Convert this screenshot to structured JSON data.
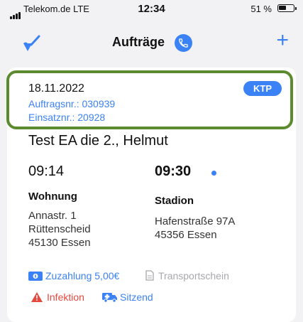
{
  "status_bar": {
    "carrier": "Telekom.de  LTE",
    "time": "12:34",
    "battery_text": "51 %",
    "battery_level": 0.51
  },
  "nav": {
    "title": "Aufträge",
    "icons": {
      "left": "broom-icon",
      "call": "phone-icon",
      "add": "plus-icon"
    },
    "add_label": "+"
  },
  "order": {
    "date": "18.11.2022",
    "order_number": "Auftragsnr.: 030939",
    "mission_number": "Einsatznr.: 20928",
    "badge": "KTP",
    "patient": "Test EA die 2., Helmut",
    "pickup_time": "09:14",
    "arrival_time": "09:30",
    "from": {
      "name": "Wohnung",
      "address": "Annastr. 1\nRüttenscheid\n45130 Essen"
    },
    "to": {
      "name": "Stadion",
      "address": "Hafenstraße 97A\n45356 Essen"
    },
    "copayment": "Zuzahlung 5,00€",
    "transport_certificate": "Transportschein",
    "infection": "Infektion",
    "seating": "Sitzend"
  },
  "colors": {
    "accent": "#3b82f6",
    "highlight": "#5c8a2e",
    "warning": "#e5483d",
    "muted": "#a8a8ad"
  }
}
